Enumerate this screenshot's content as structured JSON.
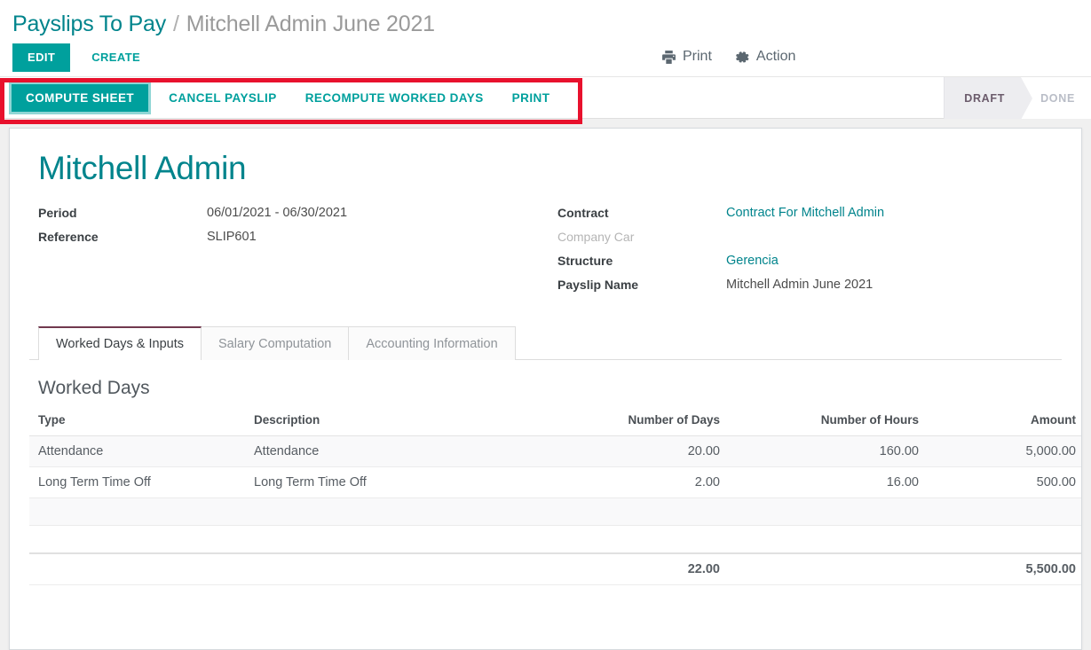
{
  "breadcrumb": {
    "parent": "Payslips To Pay",
    "separator": "/",
    "current": "Mitchell Admin June 2021"
  },
  "control_panel": {
    "edit_label": "EDIT",
    "create_label": "CREATE",
    "print_label": "Print",
    "action_label": "Action",
    "print_icon": "printer-icon",
    "action_icon": "gear-icon"
  },
  "action_bar": {
    "buttons": [
      {
        "label": "COMPUTE SHEET",
        "primary": true
      },
      {
        "label": "CANCEL PAYSLIP",
        "primary": false
      },
      {
        "label": "RECOMPUTE WORKED DAYS",
        "primary": false
      },
      {
        "label": "PRINT",
        "primary": false
      }
    ],
    "annotation_color": "#e8112d"
  },
  "status_pipeline": {
    "stages": [
      {
        "label": "DRAFT",
        "active": true
      },
      {
        "label": "DONE",
        "active": false
      }
    ]
  },
  "record": {
    "title": "Mitchell Admin",
    "left_fields": [
      {
        "label": "Period",
        "value": "06/01/2021 - 06/30/2021",
        "muted": false,
        "link": false
      },
      {
        "label": "Reference",
        "value": "SLIP601",
        "muted": false,
        "link": false
      }
    ],
    "right_fields": [
      {
        "label": "Contract",
        "value": "Contract For Mitchell Admin",
        "muted": false,
        "link": true
      },
      {
        "label": "Company Car",
        "value": "",
        "muted": true,
        "link": false
      },
      {
        "label": "Structure",
        "value": "Gerencia",
        "muted": false,
        "link": true
      },
      {
        "label": "Payslip Name",
        "value": "Mitchell Admin June 2021",
        "muted": false,
        "link": false
      }
    ]
  },
  "notebook": {
    "tabs": [
      {
        "label": "Worked Days & Inputs",
        "active": true
      },
      {
        "label": "Salary Computation",
        "active": false
      },
      {
        "label": "Accounting Information",
        "active": false
      }
    ]
  },
  "worked_days": {
    "section_title": "Worked Days",
    "columns": [
      "Type",
      "Description",
      "Number of Days",
      "Number of Hours",
      "Amount"
    ],
    "rows": [
      {
        "type": "Attendance",
        "description": "Attendance",
        "days": "20.00",
        "hours": "160.00",
        "amount": "5,000.00"
      },
      {
        "type": "Long Term Time Off",
        "description": "Long Term Time Off",
        "days": "2.00",
        "hours": "16.00",
        "amount": "500.00"
      }
    ],
    "totals": {
      "type": "",
      "description": "",
      "days": "22.00",
      "hours": "",
      "amount": "5,500.00"
    }
  },
  "theme": {
    "accent": "#00a09d",
    "link": "#00848c",
    "tab_active_border": "#71394e",
    "annotation": "#e8112d"
  }
}
